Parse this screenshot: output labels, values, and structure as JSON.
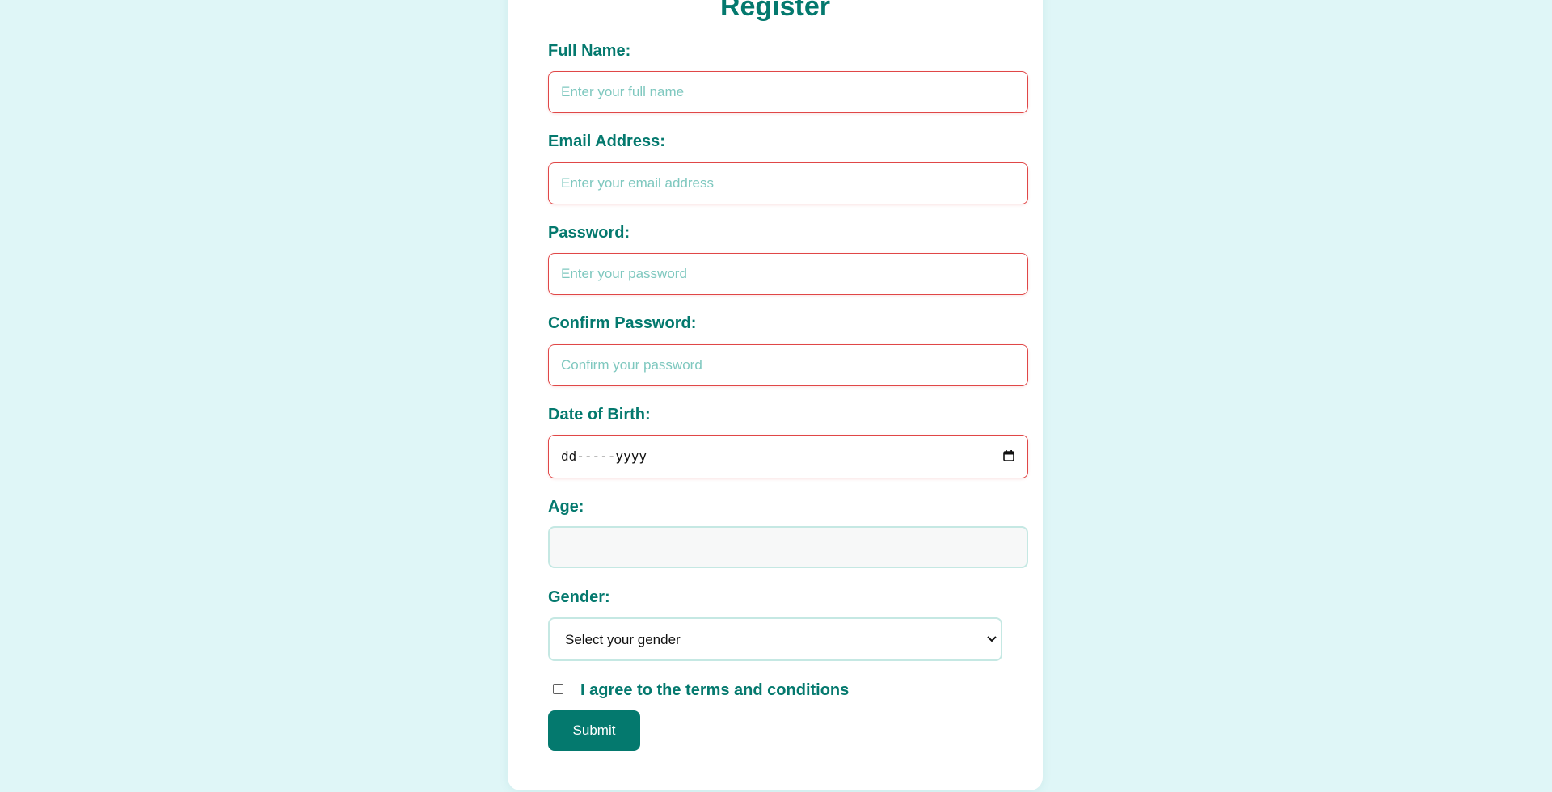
{
  "form": {
    "title": "Register",
    "full_name": {
      "label": "Full Name:",
      "placeholder": "Enter your full name",
      "value": ""
    },
    "email": {
      "label": "Email Address:",
      "placeholder": "Enter your email address",
      "value": ""
    },
    "password": {
      "label": "Password:",
      "placeholder": "Enter your password",
      "value": ""
    },
    "confirm_password": {
      "label": "Confirm Password:",
      "placeholder": "Confirm your password",
      "value": ""
    },
    "dob": {
      "label": "Date of Birth:",
      "display": "dd-----yyyy",
      "icon": "calendar-icon"
    },
    "age": {
      "label": "Age:",
      "value": ""
    },
    "gender": {
      "label": "Gender:",
      "selected": "Select your gender",
      "icon": "chevron-down-icon"
    },
    "terms": {
      "label": "I agree to the terms and conditions",
      "checked": false
    },
    "submit_label": "Submit"
  },
  "colors": {
    "background": "#dff6f7",
    "accent": "#04796e",
    "error_border": "#e04747",
    "placeholder": "#7fc8bf",
    "neutral_border": "#c5e8e3"
  }
}
